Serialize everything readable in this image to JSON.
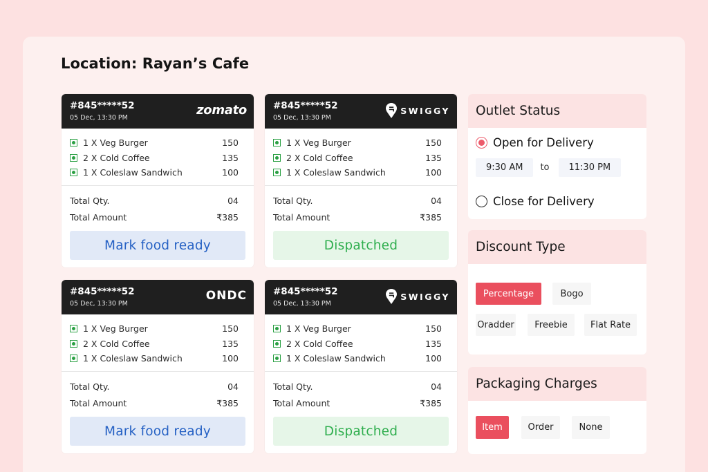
{
  "location_title": "Location: Rayan’s Cafe",
  "orders": [
    {
      "id": "#845*****52",
      "date": "05 Dec, 13:30 PM",
      "platform": "zomato",
      "items": [
        {
          "label": "1 X Veg Burger",
          "price": "150"
        },
        {
          "label": "2 X Cold Coffee",
          "price": "135"
        },
        {
          "label": "1 X Coleslaw Sandwich",
          "price": "100"
        }
      ],
      "total_qty_label": "Total Qty.",
      "total_qty": "04",
      "total_amount_label": "Total Amount",
      "total_amount": "₹385",
      "action": "Mark food ready"
    },
    {
      "id": "#845*****52",
      "date": "05 Dec, 13:30 PM",
      "platform": "SWIGGY",
      "items": [
        {
          "label": "1 X Veg Burger",
          "price": "150"
        },
        {
          "label": "2 X Cold Coffee",
          "price": "135"
        },
        {
          "label": "1 X Coleslaw Sandwich",
          "price": "100"
        }
      ],
      "total_qty_label": "Total Qty.",
      "total_qty": "04",
      "total_amount_label": "Total Amount",
      "total_amount": "₹385",
      "action": "Dispatched"
    },
    {
      "id": "#845*****52",
      "date": "05 Dec, 13:30 PM",
      "platform": "ONDC",
      "items": [
        {
          "label": "1 X Veg Burger",
          "price": "150"
        },
        {
          "label": "2 X Cold Coffee",
          "price": "135"
        },
        {
          "label": "1 X Coleslaw Sandwich",
          "price": "100"
        }
      ],
      "total_qty_label": "Total Qty.",
      "total_qty": "04",
      "total_amount_label": "Total Amount",
      "total_amount": "₹385",
      "action": "Mark food ready"
    },
    {
      "id": "#845*****52",
      "date": "05 Dec, 13:30 PM",
      "platform": "SWIGGY",
      "items": [
        {
          "label": "1 X Veg Burger",
          "price": "150"
        },
        {
          "label": "2 X Cold Coffee",
          "price": "135"
        },
        {
          "label": "1 X Coleslaw Sandwich",
          "price": "100"
        }
      ],
      "total_qty_label": "Total Qty.",
      "total_qty": "04",
      "total_amount_label": "Total Amount",
      "total_amount": "₹385",
      "action": "Dispatched"
    }
  ],
  "outlet_status": {
    "title": "Outlet Status",
    "open_label": "Open for Delivery",
    "open_selected": true,
    "from_time": "9:30 AM",
    "to_label": "to",
    "to_time": "11:30 PM",
    "close_label": "Close for Delivery"
  },
  "discount_type": {
    "title": "Discount Type",
    "options": [
      "Percentage",
      "Bogo",
      "Oradder",
      "Freebie",
      "Flat Rate"
    ],
    "selected": "Percentage"
  },
  "packaging_charges": {
    "title": "Packaging Charges",
    "options": [
      "Item",
      "Order",
      "None"
    ],
    "selected": "Item"
  },
  "colors": {
    "background": "#fde1e1",
    "accent": "#ea4f5e",
    "ready_text": "#2561c4",
    "dispatched_text": "#2fae4e",
    "veg": "#2aa043"
  }
}
